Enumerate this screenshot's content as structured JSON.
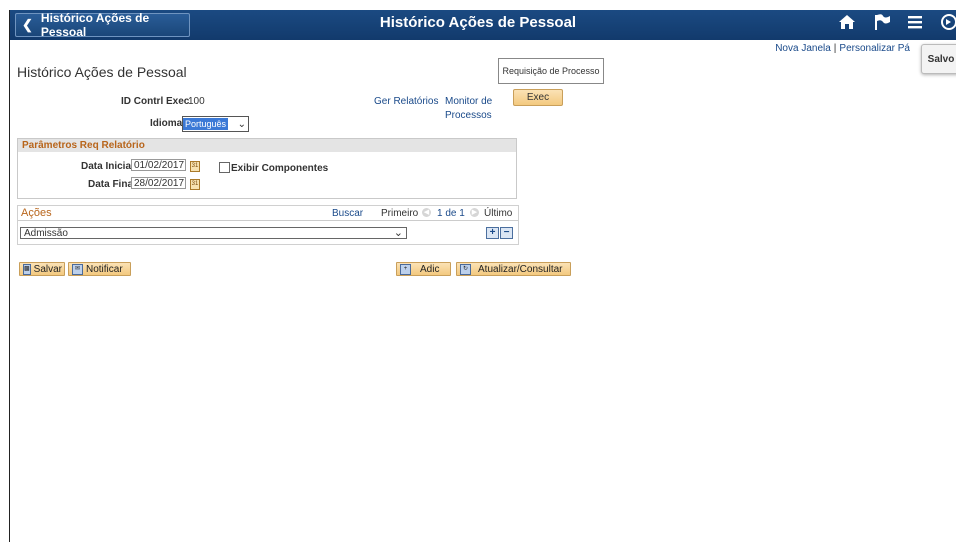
{
  "header": {
    "back_label": "Histórico Ações de Pessoal",
    "title": "Histórico Ações de Pessoal",
    "icons": [
      "home-icon",
      "flag-icon",
      "menu-icon",
      "navbar-icon"
    ]
  },
  "toplinks": {
    "new_window": "Nova Janela",
    "separator": "|",
    "personalize": "Personalizar Pá"
  },
  "salvo": "Salvo",
  "page_title": "Histórico Ações de Pessoal",
  "req_processo": "Requisição de Processo",
  "run_control": {
    "label": "ID Contrl Exec",
    "value": "100"
  },
  "links": {
    "ger_relatorios": "Ger Relatórios",
    "monitor_line1": "Monitor de",
    "monitor_line2": "Processos"
  },
  "exec_label": "Exec",
  "idioma": {
    "label": "Idioma",
    "value": "Português"
  },
  "params": {
    "header": "Parâmetros Req Relatório",
    "data_inicial_label": "Data Inicial",
    "data_inicial_value": "01/02/2017",
    "data_final_label": "Data Final",
    "data_final_value": "28/02/2017",
    "exibir_label": "Exibir Componentes"
  },
  "acoes": {
    "title": "Ações",
    "buscar": "Buscar",
    "primeiro": "Primeiro",
    "count": "1 de 1",
    "ultimo": "Último",
    "selected": "Admissão"
  },
  "buttons": {
    "salvar": "Salvar",
    "notificar": "Notificar",
    "adic": "Adic",
    "atualizar": "Atualizar/Consultar"
  },
  "colors": {
    "header_bg": "#16426f",
    "accent": "#b8651b",
    "link": "#1a4a8a",
    "button": "#f3c97f"
  }
}
